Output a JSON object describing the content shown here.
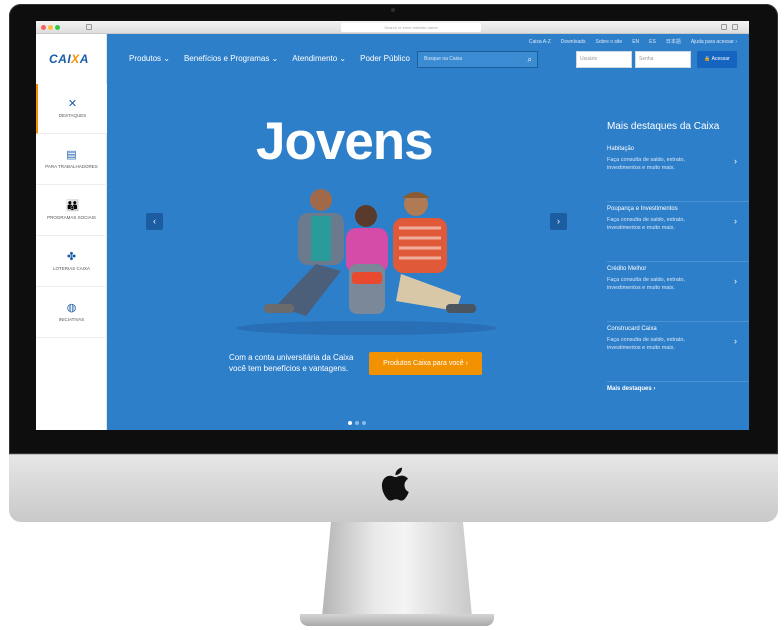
{
  "browser": {
    "address_placeholder": "Search or enter website name"
  },
  "logo": {
    "text_a": "CAI",
    "text_x": "X",
    "text_b": "A"
  },
  "sidebar": {
    "items": [
      {
        "label": "Destaques",
        "icon": "x-icon"
      },
      {
        "label": "Para trabalhadores",
        "icon": "document-icon"
      },
      {
        "label": "Programas sociais",
        "icon": "family-icon"
      },
      {
        "label": "Loterias Caixa",
        "icon": "clover-icon"
      },
      {
        "label": "Iniciativas",
        "icon": "globe-icon"
      }
    ]
  },
  "top_links": [
    "Caixa A-Z",
    "Downloads",
    "Sobre o site",
    "EN",
    "ES",
    "日本語",
    "Ajuda para acessar ›"
  ],
  "main_nav": [
    "Produtos ⌄",
    "Benefícios e Programas ⌄",
    "Atendimento ⌄",
    "Poder Público"
  ],
  "search": {
    "placeholder": "Busque na Caixa"
  },
  "login": {
    "user_placeholder": "Usuário",
    "pass_placeholder": "Senha",
    "button": "🔒 Acessar"
  },
  "hero": {
    "title": "Jovens",
    "tagline": "Com a conta universitária da Caixa você tem benefícios e vantagens.",
    "cta": "Produtos Caixa para você ›"
  },
  "highlights": {
    "title": "Mais destaques da Caixa",
    "items": [
      {
        "name": "Habitação",
        "desc": "Faça consulta de saldo, extrato, investimentos e muito mais."
      },
      {
        "name": "Poupança e Investimentos",
        "desc": "Faça consulta de saldo, extrato, investimentos e muito mais."
      },
      {
        "name": "Crédito Melhor",
        "desc": "Faça consulta de saldo, extrato, investimentos e muito mais."
      },
      {
        "name": "Construcard Caixa",
        "desc": "Faça consulta de saldo, extrato, investimentos e muito mais."
      }
    ],
    "more": "Mais destaques ›"
  },
  "slider": {
    "total": 3,
    "active": 1
  },
  "colors": {
    "brand_blue": "#2e7fca",
    "accent_orange": "#f39200",
    "logo_blue": "#1a5ca8"
  }
}
